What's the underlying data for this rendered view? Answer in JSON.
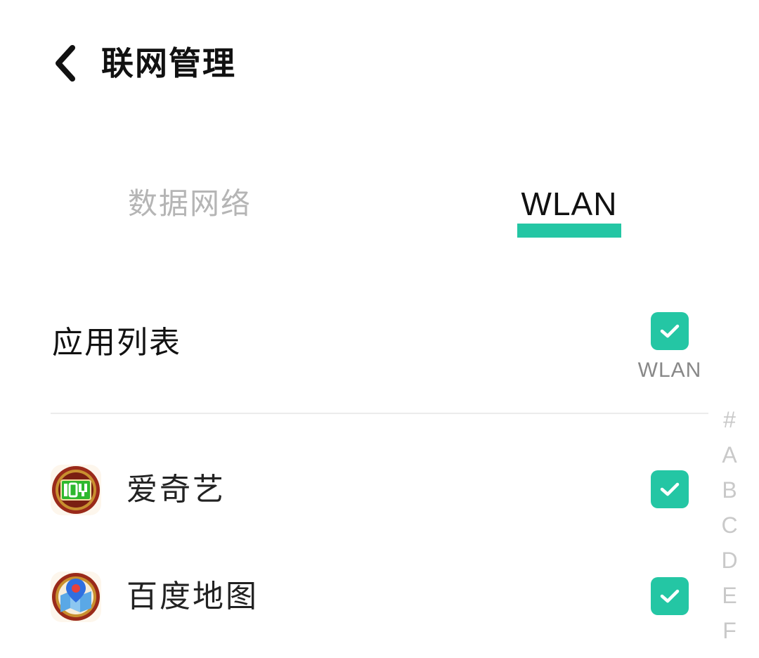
{
  "header": {
    "title": "联网管理"
  },
  "tabs": [
    {
      "label": "数据网络",
      "active": false
    },
    {
      "label": "WLAN",
      "active": true
    }
  ],
  "list": {
    "section_title": "应用列表",
    "master_checkbox": {
      "checked": true,
      "caption": "WLAN"
    }
  },
  "apps": [
    {
      "name": "爱奇艺",
      "icon": "iqiyi-icon",
      "wlan_enabled": true
    },
    {
      "name": "百度地图",
      "icon": "baidu-maps-icon",
      "wlan_enabled": true
    }
  ],
  "index_bar": [
    "#",
    "A",
    "B",
    "C",
    "D",
    "E",
    "F"
  ],
  "colors": {
    "accent": "#24c6a4",
    "inactive_tab": "#b5b5b5",
    "index_letter": "#c9c9c9"
  }
}
